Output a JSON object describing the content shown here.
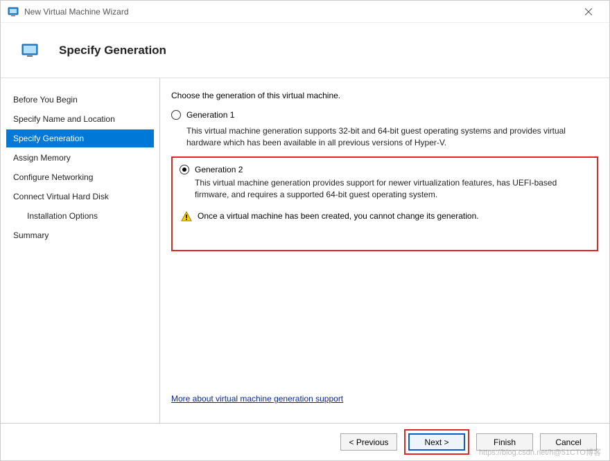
{
  "window": {
    "title": "New Virtual Machine Wizard"
  },
  "header": {
    "page_title": "Specify Generation"
  },
  "sidebar": {
    "steps": [
      {
        "label": "Before You Begin",
        "active": false,
        "indent": false
      },
      {
        "label": "Specify Name and Location",
        "active": false,
        "indent": false
      },
      {
        "label": "Specify Generation",
        "active": true,
        "indent": false
      },
      {
        "label": "Assign Memory",
        "active": false,
        "indent": false
      },
      {
        "label": "Configure Networking",
        "active": false,
        "indent": false
      },
      {
        "label": "Connect Virtual Hard Disk",
        "active": false,
        "indent": false
      },
      {
        "label": "Installation Options",
        "active": false,
        "indent": true
      },
      {
        "label": "Summary",
        "active": false,
        "indent": false
      }
    ]
  },
  "content": {
    "prompt": "Choose the generation of this virtual machine.",
    "gen1": {
      "label": "Generation 1",
      "desc": "This virtual machine generation supports 32-bit and 64-bit guest operating systems and provides virtual hardware which has been available in all previous versions of Hyper-V."
    },
    "gen2": {
      "label": "Generation 2",
      "desc": "This virtual machine generation provides support for newer virtualization features, has UEFI-based firmware, and requires a supported 64-bit guest operating system."
    },
    "warning": "Once a virtual machine has been created, you cannot change its generation.",
    "link": "More about virtual machine generation support"
  },
  "footer": {
    "previous": "< Previous",
    "next": "Next >",
    "finish": "Finish",
    "cancel": "Cancel"
  },
  "watermark": "https://blog.csdn.net/h@51CTO博客"
}
